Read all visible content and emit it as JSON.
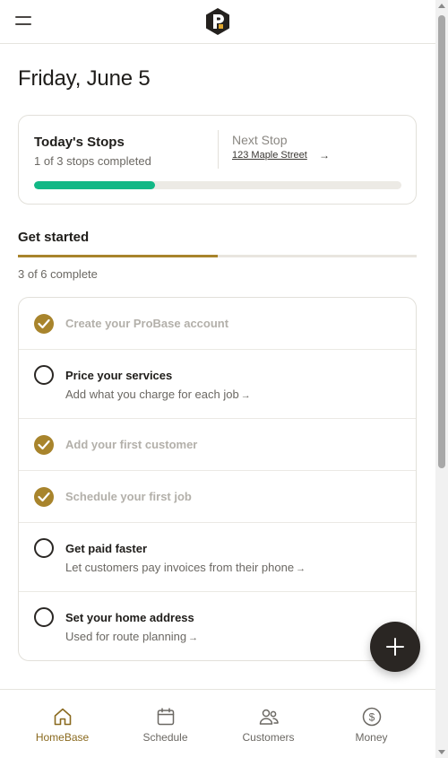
{
  "header": {
    "menu_icon": "hamburger-icon",
    "logo_icon": "probase-logo"
  },
  "page": {
    "date_title": "Friday, June 5"
  },
  "stops": {
    "title": "Today's Stops",
    "subtitle": "1 of 3 stops completed",
    "next_label": "Next Stop",
    "next_address": "123 Maple Street",
    "next_arrow": "→",
    "progress": 0.33,
    "progress_color": "#12b886"
  },
  "get_started": {
    "heading": "Get started",
    "count": "3 of 6 complete",
    "progress": 0.5,
    "accent_color": "#a8842c",
    "tasks": [
      {
        "title": "Create your ProBase account",
        "desc": "",
        "done": true
      },
      {
        "title": "Price your services",
        "desc": "Add what you charge for each job",
        "done": false
      },
      {
        "title": "Add your first customer",
        "desc": "",
        "done": true
      },
      {
        "title": "Schedule your first job",
        "desc": "",
        "done": true
      },
      {
        "title": "Get paid faster",
        "desc": "Let customers pay invoices from their phone",
        "done": false
      },
      {
        "title": "Set your home address",
        "desc": "Used for route planning",
        "done": false
      }
    ],
    "arrow": "→"
  },
  "fab": {
    "icon": "plus-icon"
  },
  "bottom_nav": {
    "items": [
      {
        "label": "HomeBase",
        "icon": "home-icon",
        "active": true
      },
      {
        "label": "Schedule",
        "icon": "calendar-icon",
        "active": false
      },
      {
        "label": "Customers",
        "icon": "users-icon",
        "active": false
      },
      {
        "label": "Money",
        "icon": "dollar-circle-icon",
        "active": false
      }
    ]
  }
}
